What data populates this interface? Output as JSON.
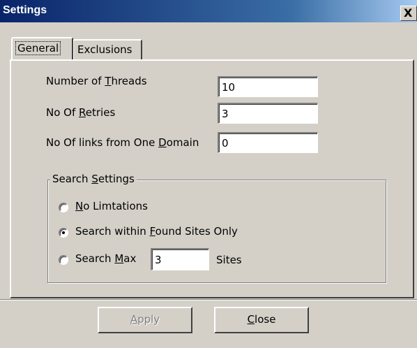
{
  "window": {
    "title": "Settings",
    "close_label": "X"
  },
  "tabs": [
    {
      "label": "General",
      "active": true
    },
    {
      "label": "Exclusions",
      "active": false
    }
  ],
  "fields": {
    "threads": {
      "label_pre": "Number of ",
      "label_u": "T",
      "label_post": "hreads",
      "value": "10"
    },
    "retries": {
      "label_pre": "No Of ",
      "label_u": "R",
      "label_post": "etries",
      "value": "3"
    },
    "links": {
      "label_pre": "No Of links from One ",
      "label_u": "D",
      "label_post": "omain",
      "value": "0"
    }
  },
  "search_settings": {
    "title_pre": "Search ",
    "title_u": "S",
    "title_post": "ettings",
    "options": [
      {
        "pre": "",
        "u": "N",
        "post": "o Limtations",
        "selected": false
      },
      {
        "pre": "Search within ",
        "u": "F",
        "post": "ound Sites Only",
        "selected": true
      },
      {
        "pre": "Search ",
        "u": "M",
        "post": "ax",
        "selected": false
      }
    ],
    "max_value": "3",
    "max_suffix": "Sites"
  },
  "buttons": {
    "apply": {
      "u": "A",
      "rest": "pply",
      "disabled": true
    },
    "close": {
      "u": "C",
      "rest": "lose",
      "disabled": false
    }
  }
}
